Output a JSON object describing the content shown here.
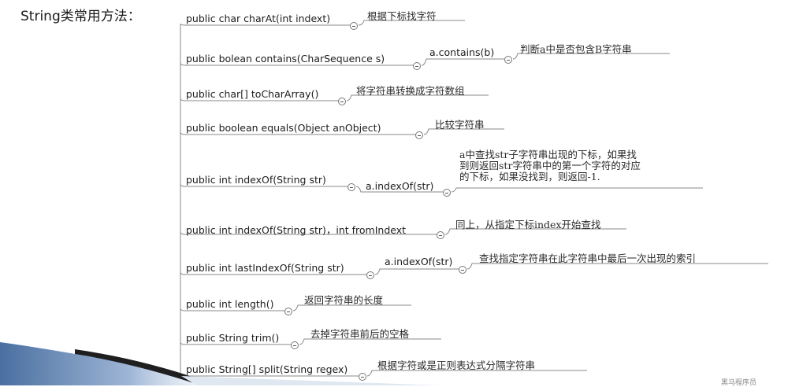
{
  "title": "String类常用方法：",
  "methods": [
    {
      "signature": "public  char  charAt(int  indext)",
      "description": "根据下标找字符"
    },
    {
      "signature": "public  bolean  contains(CharSequence  s)",
      "example": "a.contains(b)",
      "description": "判断a中是否包含B字符串"
    },
    {
      "signature": "public  char[]  toCharArray()",
      "description": "将字符串转换成字符数组"
    },
    {
      "signature": "public   boolean   equals(Object   anObject)",
      "description": "比较字符串"
    },
    {
      "signature": "public  int  indexOf(String   str)",
      "example": "a.indexOf(str)",
      "description_lines": [
        "a中查找str子字符串出现的下标，如果找",
        "到则返回str字符串中的第一个字符的对应",
        "的下标，如果没找到，则返回-1."
      ]
    },
    {
      "signature": "public  int  indexOf(String   str)，int  fromIndext",
      "description": "同上，从指定下标index开始查找"
    },
    {
      "signature": "public  int  lastIndexOf(String   str)",
      "example": "a.indexOf(str)",
      "description": "查找指定字符串在此字符串中最后一次出现的索引"
    },
    {
      "signature": "public  int  length()",
      "description": "返回字符串的长度"
    },
    {
      "signature": "public  String  trim()",
      "description": "去掉字符串前后的空格"
    },
    {
      "signature": "public String[]  split(String regex)",
      "description": "根据字符或是正则表达式分隔字符串"
    }
  ],
  "footer": "黑马程序员"
}
